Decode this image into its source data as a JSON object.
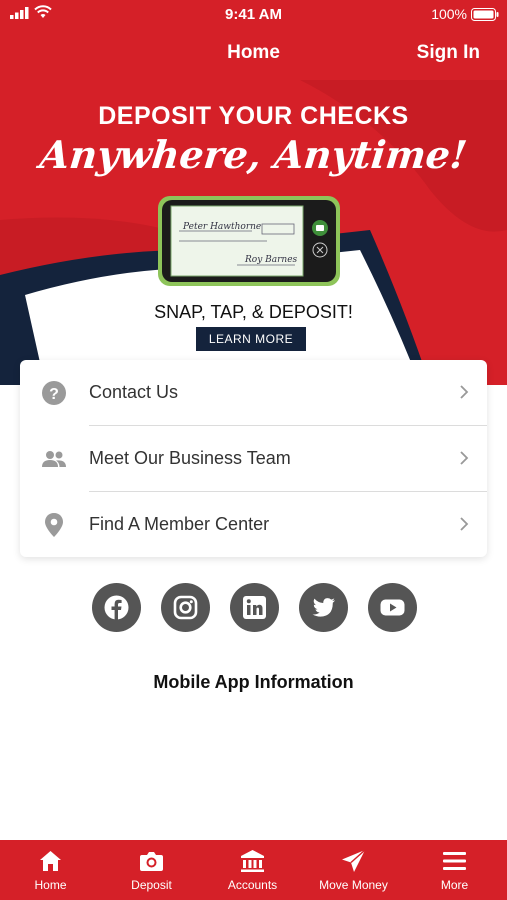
{
  "status_bar": {
    "time": "9:41 AM",
    "battery": "100%"
  },
  "header": {
    "title": "Home",
    "sign_in": "Sign In"
  },
  "banner": {
    "headline": "DEPOSIT YOUR CHECKS",
    "script": "Anywhere, Anytime!",
    "tagline": "SNAP, TAP, & DEPOSIT!",
    "cta": "LEARN MORE",
    "check_payee": "Peter Hawthorne",
    "check_signature": "Roy Barnes"
  },
  "menu": {
    "items": [
      {
        "label": "Contact Us",
        "icon": "help-circle-icon"
      },
      {
        "label": "Meet Our Business Team",
        "icon": "people-icon"
      },
      {
        "label": "Find A Member Center",
        "icon": "location-pin-icon"
      }
    ]
  },
  "social": [
    "facebook-icon",
    "instagram-icon",
    "linkedin-icon",
    "twitter-icon",
    "youtube-icon"
  ],
  "app_info": "Mobile App Information",
  "tabs": [
    {
      "label": "Home",
      "icon": "home-icon"
    },
    {
      "label": "Deposit",
      "icon": "camera-icon"
    },
    {
      "label": "Accounts",
      "icon": "bank-icon"
    },
    {
      "label": "Move Money",
      "icon": "send-icon"
    },
    {
      "label": "More",
      "icon": "menu-icon"
    }
  ],
  "colors": {
    "brand_red": "#d52028",
    "navy": "#14233c",
    "icon_gray": "#555555"
  }
}
